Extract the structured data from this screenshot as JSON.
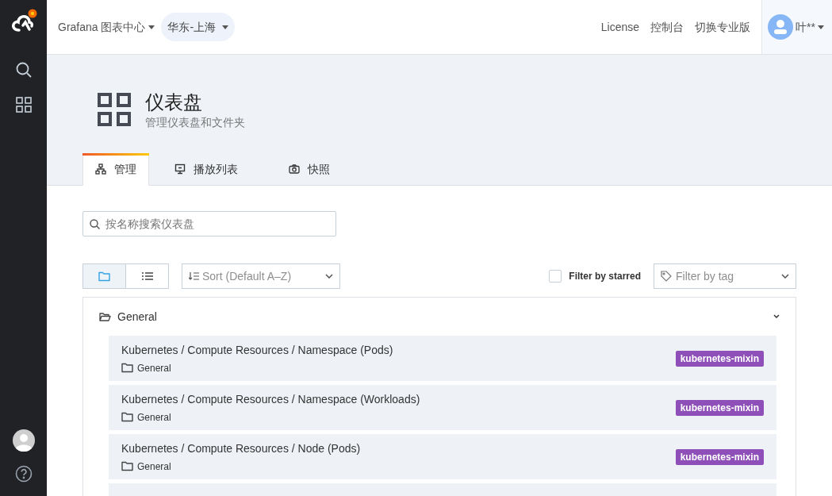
{
  "topbar": {
    "product": "Grafana 图表中心",
    "region": "华东-上海",
    "links": [
      "License",
      "控制台",
      "切换专业版"
    ],
    "user": "叶**"
  },
  "header": {
    "title": "仪表盘",
    "subtitle": "管理仪表盘和文件夹"
  },
  "tabs": [
    {
      "label": "管理",
      "kind": "sitemap",
      "selected": true
    },
    {
      "label": "播放列表",
      "kind": "presentation",
      "selected": false
    },
    {
      "label": "快照",
      "kind": "camera",
      "selected": false
    }
  ],
  "search": {
    "placeholder": "按名称搜索仪表盘"
  },
  "view_toggle": [
    {
      "kind": "folder",
      "selected": true
    },
    {
      "kind": "list",
      "selected": false
    }
  ],
  "sort": {
    "placeholder": "Sort (Default A‒Z)"
  },
  "starred_filter": {
    "label": "Filter by starred",
    "checked": false
  },
  "tag_filter": {
    "placeholder": "Filter by tag"
  },
  "folder": {
    "name": "General",
    "expanded": true,
    "dashboards": [
      {
        "title": "Kubernetes / Compute Resources / Namespace (Pods)",
        "folder": "General",
        "tag": "kubernetes-mixin",
        "color": "#8f4fb8"
      },
      {
        "title": "Kubernetes / Compute Resources / Namespace (Workloads)",
        "folder": "General",
        "tag": "kubernetes-mixin",
        "color": "#8f4fb8"
      },
      {
        "title": "Kubernetes / Compute Resources / Node (Pods)",
        "folder": "General",
        "tag": "kubernetes-mixin",
        "color": "#8f4fb8"
      }
    ]
  }
}
